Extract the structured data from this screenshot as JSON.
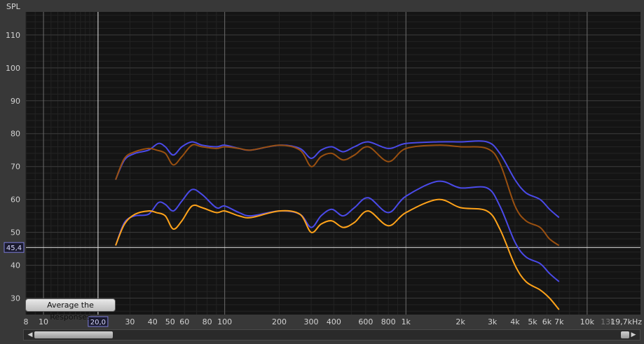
{
  "y_axis_label": "SPL",
  "cursor_y_value": "45,4",
  "cursor_x_value": "20,0",
  "average_button_label": "Average the Responses",
  "colors": {
    "background": "#141414",
    "grid_major": "#3b3b3b",
    "grid_minor": "#232323",
    "highlight_line": "#e6e6e6",
    "series_blue": "#4a4ae8",
    "series_brown": "#9a5010",
    "series_orange": "#ffa31a"
  },
  "chart_data": {
    "type": "line",
    "xscale": "log",
    "xlim": [
      8,
      19700
    ],
    "ylim": [
      25,
      117
    ],
    "ylabel": "SPL",
    "x_tick_labels": [
      {
        "x": 8,
        "label": "8"
      },
      {
        "x": 10,
        "label": "10"
      },
      {
        "x": 30,
        "label": "30"
      },
      {
        "x": 40,
        "label": "40"
      },
      {
        "x": 50,
        "label": "50"
      },
      {
        "x": 60,
        "label": "60"
      },
      {
        "x": 80,
        "label": "80"
      },
      {
        "x": 100,
        "label": "100"
      },
      {
        "x": 200,
        "label": "200"
      },
      {
        "x": 300,
        "label": "300"
      },
      {
        "x": 400,
        "label": "400"
      },
      {
        "x": 600,
        "label": "600"
      },
      {
        "x": 800,
        "label": "800"
      },
      {
        "x": 1000,
        "label": "1k"
      },
      {
        "x": 2000,
        "label": "2k"
      },
      {
        "x": 3000,
        "label": "3k"
      },
      {
        "x": 4000,
        "label": "4k"
      },
      {
        "x": 5000,
        "label": "5k"
      },
      {
        "x": 6000,
        "label": "6k"
      },
      {
        "x": 7000,
        "label": "7k"
      },
      {
        "x": 10000,
        "label": "10k"
      },
      {
        "x": 13000,
        "label": "13k"
      },
      {
        "x": 19700,
        "label": "19,7kHz"
      }
    ],
    "y_ticks": [
      30,
      40,
      50,
      60,
      70,
      80,
      90,
      100,
      110
    ],
    "cursor": {
      "x": 20,
      "y": 45.4
    },
    "series": [
      {
        "color": "#4a4ae8",
        "points": [
          [
            25,
            66
          ],
          [
            28,
            72
          ],
          [
            32,
            74
          ],
          [
            38,
            75
          ],
          [
            43,
            77
          ],
          [
            47,
            76
          ],
          [
            52,
            73.5
          ],
          [
            58,
            76
          ],
          [
            66,
            77.5
          ],
          [
            75,
            76.5
          ],
          [
            90,
            76
          ],
          [
            100,
            76.5
          ],
          [
            120,
            75.5
          ],
          [
            140,
            75
          ],
          [
            200,
            76.5
          ],
          [
            260,
            75.5
          ],
          [
            300,
            72.5
          ],
          [
            340,
            75
          ],
          [
            390,
            76
          ],
          [
            450,
            74.5
          ],
          [
            520,
            76
          ],
          [
            620,
            77.5
          ],
          [
            800,
            75.5
          ],
          [
            1000,
            77
          ],
          [
            1500,
            77.5
          ],
          [
            2000,
            77.5
          ],
          [
            2800,
            77.5
          ],
          [
            3300,
            74
          ],
          [
            4000,
            66
          ],
          [
            4600,
            62
          ],
          [
            5500,
            60
          ],
          [
            6200,
            57
          ],
          [
            7000,
            54.5
          ]
        ]
      },
      {
        "color": "#9a5010",
        "points": [
          [
            25,
            66
          ],
          [
            28,
            72.5
          ],
          [
            32,
            74.5
          ],
          [
            38,
            75.5
          ],
          [
            42,
            75
          ],
          [
            47,
            74
          ],
          [
            52,
            70.5
          ],
          [
            58,
            73
          ],
          [
            66,
            76.5
          ],
          [
            75,
            76
          ],
          [
            90,
            75.5
          ],
          [
            100,
            76
          ],
          [
            120,
            75.5
          ],
          [
            140,
            75
          ],
          [
            200,
            76.5
          ],
          [
            260,
            75
          ],
          [
            300,
            70
          ],
          [
            340,
            73
          ],
          [
            390,
            74
          ],
          [
            450,
            72
          ],
          [
            520,
            73.5
          ],
          [
            620,
            76
          ],
          [
            800,
            71.5
          ],
          [
            1000,
            75.5
          ],
          [
            1500,
            76.5
          ],
          [
            2000,
            76
          ],
          [
            2800,
            75.5
          ],
          [
            3300,
            71
          ],
          [
            4000,
            58
          ],
          [
            4600,
            53.5
          ],
          [
            5500,
            51.5
          ],
          [
            6200,
            48
          ],
          [
            7000,
            46
          ]
        ]
      },
      {
        "color": "#4a4ae8",
        "points": [
          [
            25,
            46
          ],
          [
            28,
            53
          ],
          [
            32,
            55
          ],
          [
            38,
            55.5
          ],
          [
            43,
            59
          ],
          [
            47,
            58.5
          ],
          [
            52,
            56.5
          ],
          [
            58,
            59.5
          ],
          [
            66,
            63
          ],
          [
            75,
            61.5
          ],
          [
            90,
            57.5
          ],
          [
            100,
            58
          ],
          [
            120,
            56
          ],
          [
            140,
            55
          ],
          [
            200,
            56.5
          ],
          [
            260,
            55.5
          ],
          [
            300,
            51.5
          ],
          [
            340,
            55
          ],
          [
            390,
            57
          ],
          [
            450,
            55
          ],
          [
            520,
            57.5
          ],
          [
            620,
            60.5
          ],
          [
            800,
            56
          ],
          [
            1000,
            61
          ],
          [
            1500,
            65.5
          ],
          [
            2000,
            63.5
          ],
          [
            2800,
            63.5
          ],
          [
            3300,
            58
          ],
          [
            4000,
            47
          ],
          [
            4600,
            42.5
          ],
          [
            5500,
            40.5
          ],
          [
            6200,
            37.5
          ],
          [
            7000,
            35
          ]
        ]
      },
      {
        "color": "#ffa31a",
        "points": [
          [
            25,
            46
          ],
          [
            28,
            52.5
          ],
          [
            32,
            55.5
          ],
          [
            38,
            56.5
          ],
          [
            42,
            56
          ],
          [
            47,
            55
          ],
          [
            52,
            51
          ],
          [
            58,
            53.5
          ],
          [
            66,
            58
          ],
          [
            75,
            57.5
          ],
          [
            90,
            56
          ],
          [
            100,
            56.5
          ],
          [
            120,
            55
          ],
          [
            140,
            54.5
          ],
          [
            200,
            56.5
          ],
          [
            260,
            55.5
          ],
          [
            300,
            50
          ],
          [
            340,
            52.5
          ],
          [
            390,
            53.5
          ],
          [
            450,
            51.5
          ],
          [
            520,
            53
          ],
          [
            620,
            56.5
          ],
          [
            800,
            52
          ],
          [
            1000,
            56
          ],
          [
            1500,
            60
          ],
          [
            2000,
            57.5
          ],
          [
            2800,
            56.5
          ],
          [
            3300,
            51
          ],
          [
            4000,
            40
          ],
          [
            4600,
            35
          ],
          [
            5500,
            32.5
          ],
          [
            6200,
            30
          ],
          [
            7000,
            26.5
          ]
        ]
      }
    ]
  }
}
